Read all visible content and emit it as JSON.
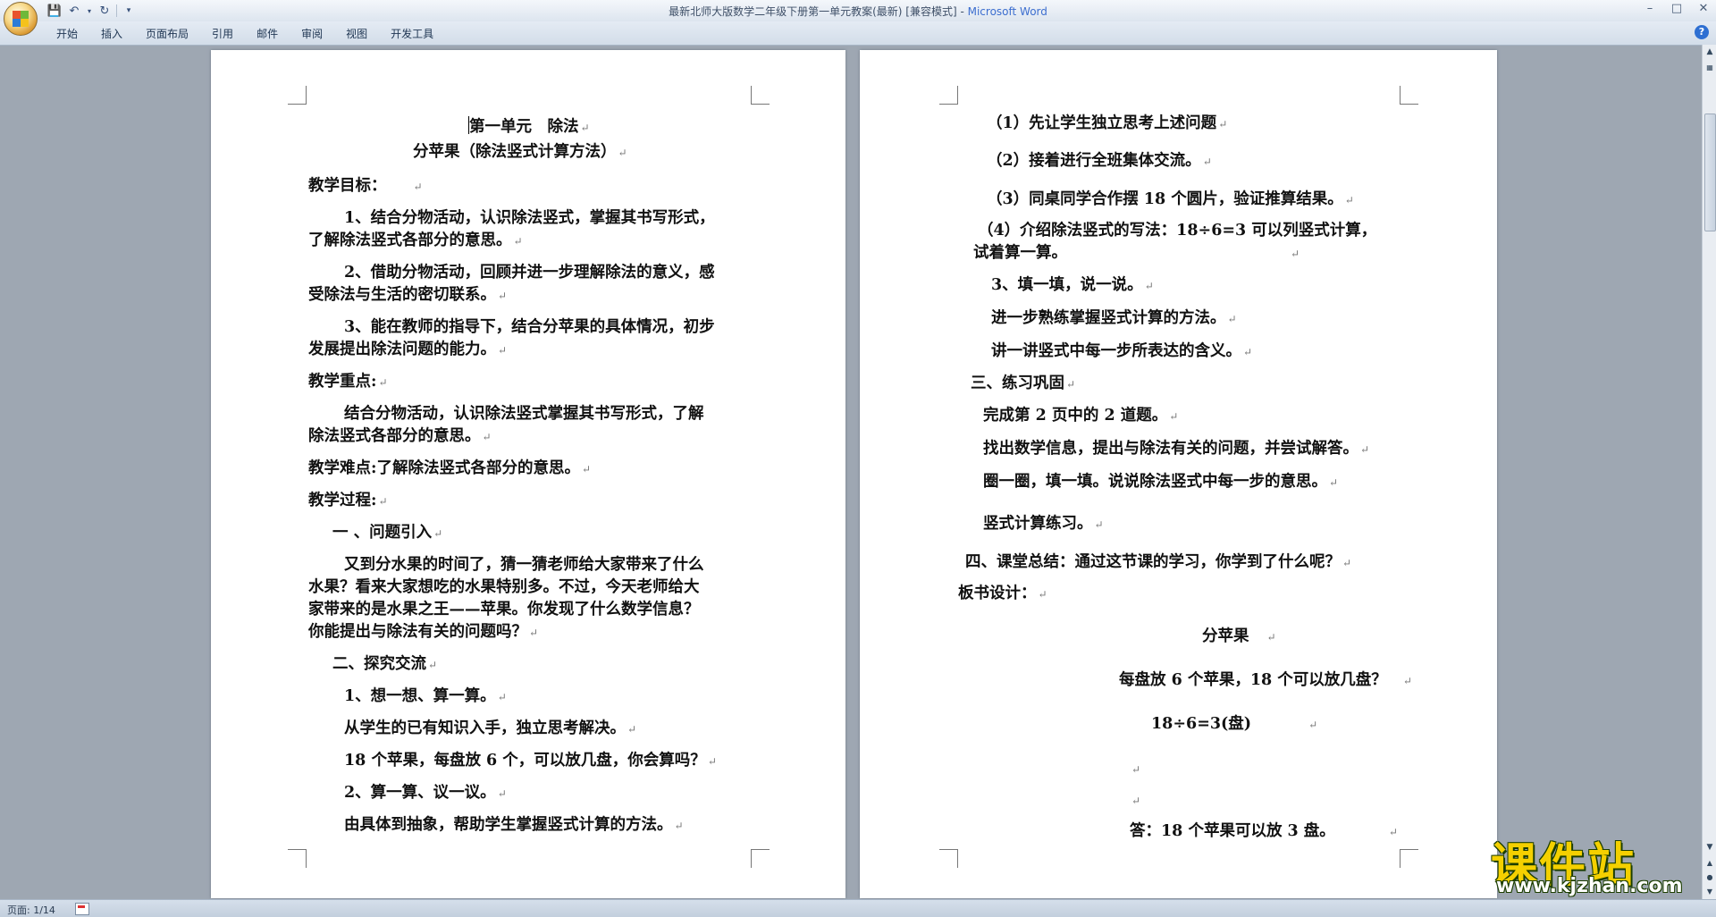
{
  "window": {
    "title_doc": "最新北师大版数学二年级下册第一单元教案(最新) [兼容模式] - ",
    "title_app": "Microsoft Word"
  },
  "ribbon": {
    "tabs": [
      "开始",
      "插入",
      "页面布局",
      "引用",
      "邮件",
      "审阅",
      "视图",
      "开发工具"
    ]
  },
  "page_left": {
    "lines": [
      "第一单元　除法",
      "分苹果（除法竖式计算方法）",
      "教学目标：",
      "1、结合分物活动，认识除法竖式，掌握其书写形式，",
      "了解除法竖式各部分的意思。",
      "2、借助分物活动，回顾并进一步理解除法的意义，感",
      "受除法与生活的密切联系。",
      "3、能在教师的指导下，结合分苹果的具体情况，初步",
      "发展提出除法问题的能力。",
      "教学重点:",
      "结合分物活动，认识除法竖式掌握其书写形式，了解",
      "除法竖式各部分的意思。",
      "教学难点:了解除法竖式各部分的意思。",
      "教学过程:",
      "一 、问题引入",
      "又到分水果的时间了，猜一猜老师给大家带来了什么",
      "水果？看来大家想吃的水果特别多。不过，今天老师给大",
      "家带来的是水果之王——苹果。你发现了什么数学信息？",
      "你能提出与除法有关的问题吗？",
      "二、探究交流",
      "1、想一想、算一算。",
      "从学生的已有知识入手，独立思考解决。",
      "18 个苹果，每盘放 6 个，可以放几盘，你会算吗？",
      "2、算一算、议一议。",
      "由具体到抽象，帮助学生掌握竖式计算的方法。"
    ]
  },
  "page_right": {
    "lines": [
      "（1）先让学生独立思考上述问题",
      "（2）接着进行全班集体交流。",
      "（3）同桌同学合作摆 18 个圆片，验证推算结果。",
      "（4）介绍除法竖式的写法：18÷6=3 可以列竖式计算，",
      "试着算一算。",
      "3、填一填，说一说。",
      "进一步熟练掌握竖式计算的方法。",
      "讲一讲竖式中每一步所表达的含义。",
      "三、练习巩固",
      "完成第 2 页中的 2 道题。",
      "找出数学信息，提出与除法有关的问题，并尝试解答。",
      "圈一圈，填一填。说说除法竖式中每一步的意思。",
      "竖式计算练习。",
      "四、课堂总结：通过这节课的学习，你学到了什么呢？",
      "板书设计：",
      "分苹果",
      "每盘放 6 个苹果，18 个可以放几盘？",
      "18÷6=3(盘)",
      "答：18 个苹果可以放 3 盘。"
    ]
  },
  "status": {
    "page": "页面: 1/14"
  },
  "watermark": {
    "title": "课件站",
    "url": "www.kjzhan.com"
  },
  "colors": {
    "title_app": "#3c6ecf",
    "watermark_yellow": "#f4d000",
    "workspace": "#9ea7b2"
  }
}
